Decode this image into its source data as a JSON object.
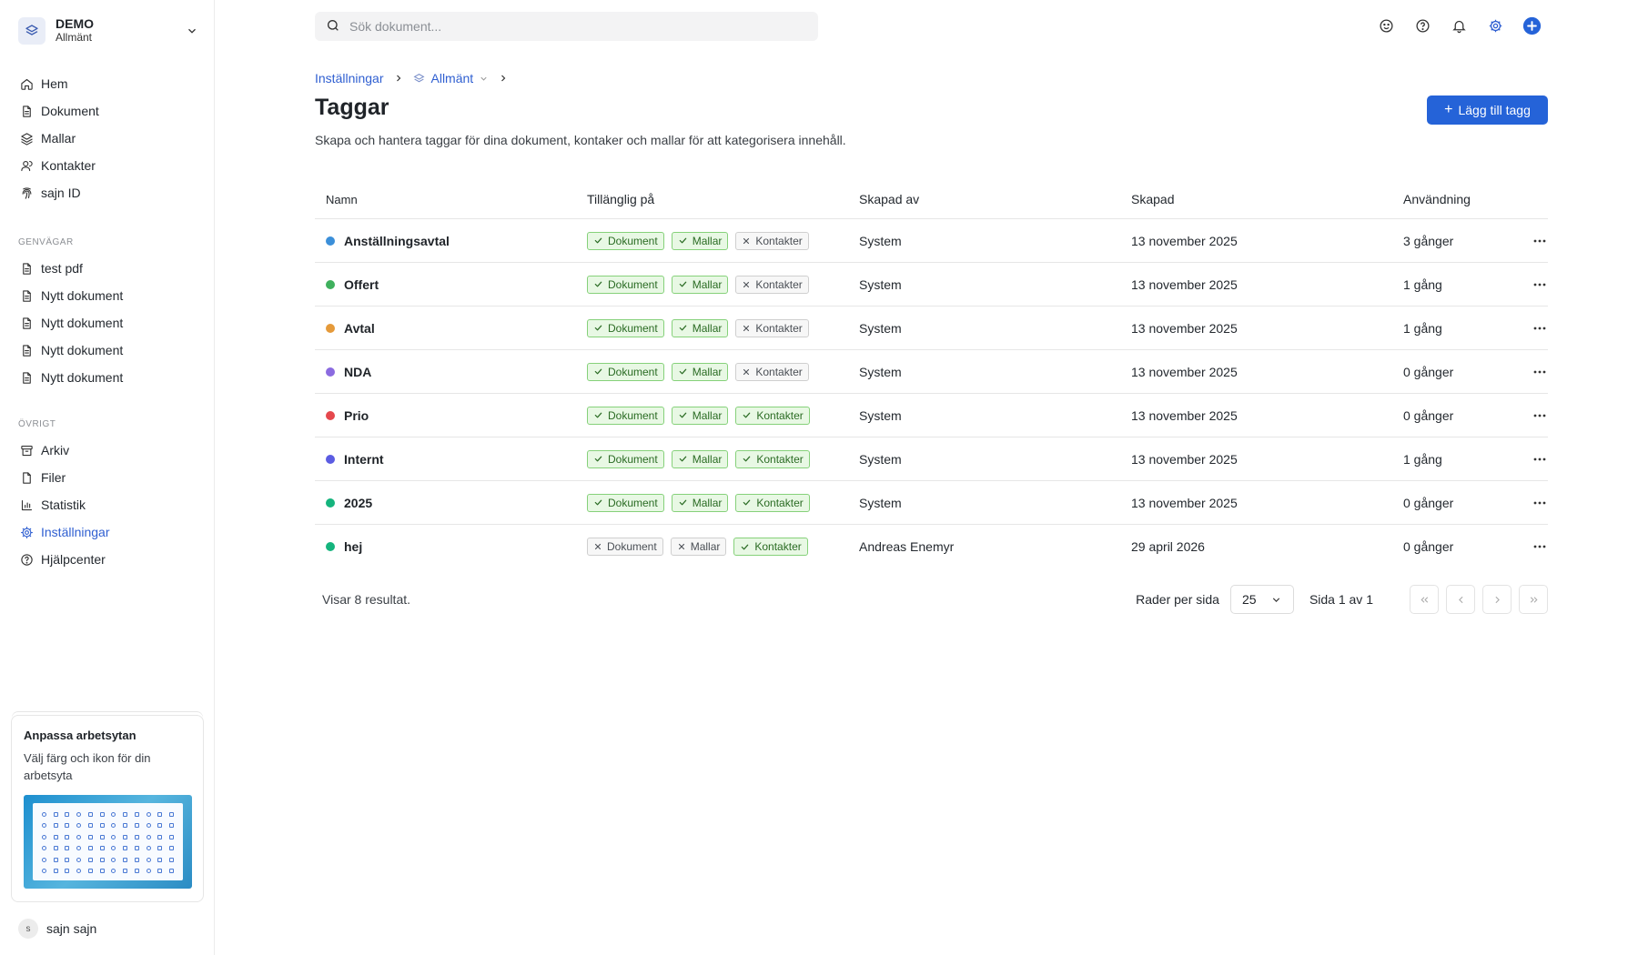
{
  "workspace": {
    "name": "DEMO",
    "sub": "Allmänt"
  },
  "nav": [
    {
      "label": "Hem",
      "icon": "home-icon"
    },
    {
      "label": "Dokument",
      "icon": "document-icon"
    },
    {
      "label": "Mallar",
      "icon": "layers-icon"
    },
    {
      "label": "Kontakter",
      "icon": "contacts-icon"
    },
    {
      "label": "sajn ID",
      "icon": "fingerprint-icon"
    }
  ],
  "shortcuts": {
    "label": "GENVÄGAR",
    "items": [
      "test pdf",
      "Nytt dokument",
      "Nytt dokument",
      "Nytt dokument",
      "Nytt dokument"
    ]
  },
  "other": {
    "label": "ÖVRIGT",
    "items": [
      {
        "label": "Arkiv",
        "icon": "archive-icon"
      },
      {
        "label": "Filer",
        "icon": "file-icon"
      },
      {
        "label": "Statistik",
        "icon": "chart-icon"
      },
      {
        "label": "Inställningar",
        "icon": "gear-icon",
        "active": true
      },
      {
        "label": "Hjälpcenter",
        "icon": "help-icon"
      }
    ]
  },
  "promo": {
    "title": "Anpassa arbetsytan",
    "text": "Välj färg och ikon för din arbetsyta"
  },
  "user": {
    "initial": "s",
    "name": "sajn sajn"
  },
  "search": {
    "placeholder": "Sök dokument..."
  },
  "breadcrumb": {
    "root": "Inställningar",
    "current": "Allmänt"
  },
  "page": {
    "title": "Taggar",
    "description": "Skapa och hantera taggar för dina dokument, kontaker och mallar för att kategorisera innehåll.",
    "add_label": "Lägg till tagg"
  },
  "table": {
    "headers": {
      "name": "Namn",
      "available": "Tillänglig på",
      "created_by": "Skapad av",
      "created": "Skapad",
      "usage": "Användning"
    },
    "pill_labels": {
      "documents": "Dokument",
      "templates": "Mallar",
      "contacts": "Kontakter"
    },
    "rows": [
      {
        "name": "Anställningsavtal",
        "color": "#3b8fd9",
        "documents": true,
        "templates": true,
        "contacts": false,
        "created_by": "System",
        "created": "13 november 2025",
        "usage": "3 gånger"
      },
      {
        "name": "Offert",
        "color": "#3fb05d",
        "documents": true,
        "templates": true,
        "contacts": false,
        "created_by": "System",
        "created": "13 november 2025",
        "usage": "1 gång"
      },
      {
        "name": "Avtal",
        "color": "#e59a3a",
        "documents": true,
        "templates": true,
        "contacts": false,
        "created_by": "System",
        "created": "13 november 2025",
        "usage": "1 gång"
      },
      {
        "name": "NDA",
        "color": "#8b6be0",
        "documents": true,
        "templates": true,
        "contacts": false,
        "created_by": "System",
        "created": "13 november 2025",
        "usage": "0 gånger"
      },
      {
        "name": "Prio",
        "color": "#e5484d",
        "documents": true,
        "templates": true,
        "contacts": true,
        "created_by": "System",
        "created": "13 november 2025",
        "usage": "0 gånger"
      },
      {
        "name": "Internt",
        "color": "#5b5ce2",
        "documents": true,
        "templates": true,
        "contacts": true,
        "created_by": "System",
        "created": "13 november 2025",
        "usage": "1 gång"
      },
      {
        "name": "2025",
        "color": "#15b47d",
        "documents": true,
        "templates": true,
        "contacts": true,
        "created_by": "System",
        "created": "13 november 2025",
        "usage": "0 gånger"
      },
      {
        "name": "hej",
        "color": "#15b47d",
        "documents": false,
        "templates": false,
        "contacts": true,
        "created_by": "Andreas Enemyr",
        "created": "29 april 2026",
        "usage": "0 gånger"
      }
    ]
  },
  "footer": {
    "count": "Visar 8 resultat.",
    "rows_label": "Rader per sida",
    "rows_value": "25",
    "page_info": "Sida 1 av 1"
  },
  "colors": {
    "accent": "#2563d8",
    "link": "#2f5fd1",
    "pill_on_bg": "#e8f8e4",
    "pill_on_border": "#86d17a"
  }
}
